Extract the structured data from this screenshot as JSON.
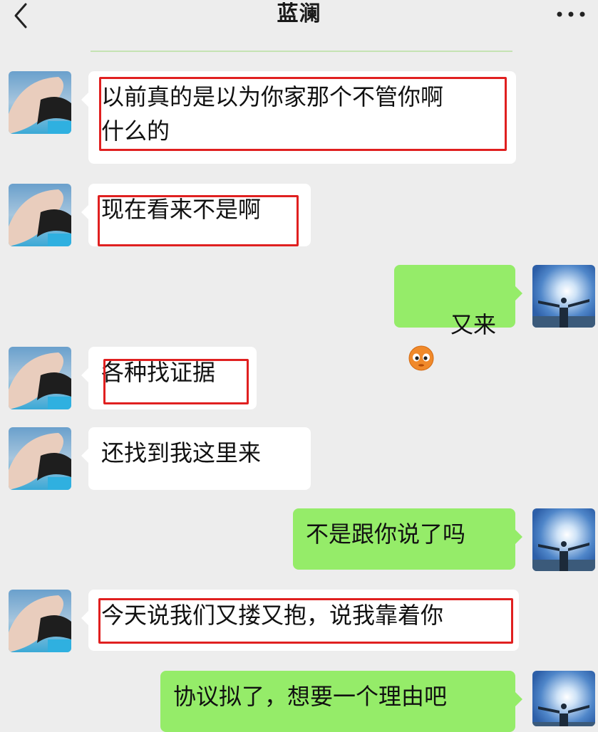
{
  "header": {
    "title": "蓝澜",
    "back_icon": "chevron-left-icon",
    "more_icon": "more-dots-icon"
  },
  "colors": {
    "background": "#ededed",
    "incoming_bubble": "#ffffff",
    "outgoing_bubble": "#95ec69",
    "highlight_box": "#e02020"
  },
  "messages": [
    {
      "sender": "contact",
      "text": "以前真的是以为你家那个不管你啊\n什么的",
      "highlighted": true
    },
    {
      "sender": "contact",
      "text": "现在看来不是啊",
      "highlighted": true
    },
    {
      "sender": "me",
      "text": "又来",
      "emoji": "blushing-face-icon",
      "highlighted": false
    },
    {
      "sender": "contact",
      "text": "各种找证据",
      "highlighted": true
    },
    {
      "sender": "contact",
      "text": "还找到我这里来",
      "highlighted": false
    },
    {
      "sender": "me",
      "text": "不是跟你说了吗",
      "highlighted": false
    },
    {
      "sender": "contact",
      "text": "今天说我们又搂又抱，说我靠着你",
      "highlighted": true
    },
    {
      "sender": "me",
      "text": "协议拟了，想要一个理由吧",
      "highlighted": false
    }
  ]
}
